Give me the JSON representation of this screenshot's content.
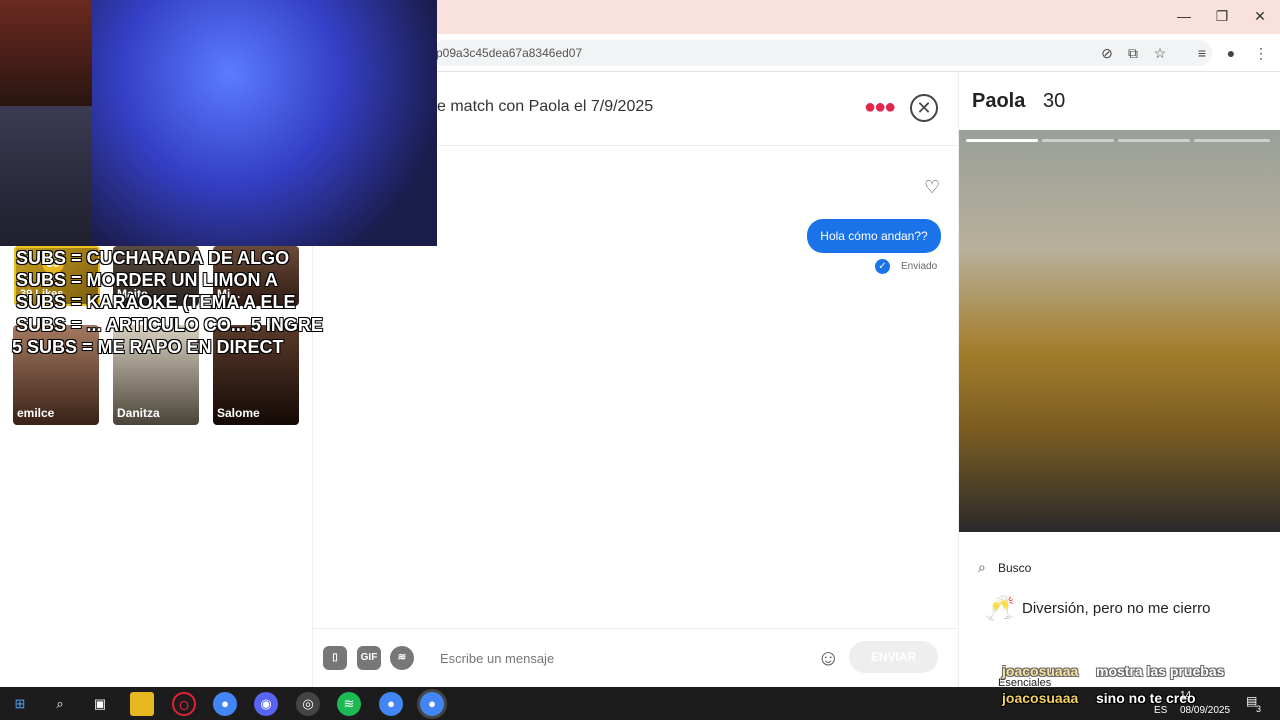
{
  "browser": {
    "url": "p09a3c45dea67a8346ed07",
    "window_controls": {
      "minimize": "—",
      "maximize": "❐",
      "close": "✕"
    }
  },
  "stream_overlay": {
    "lines": [
      "SUBS = CUCHARADA DE ALGO",
      "SUBS = MORDER UN LIMON A",
      "SUBS = KARAOKE (TEMA A ELE",
      "SUBS = ... ARTICULO CO... 5 INGRE",
      "5 SUBS = ME RAPO EN DIRECT"
    ],
    "chat": [
      {
        "user": "joacosuaaa",
        "message": "mostra las pruebas"
      },
      {
        "user": "joacosuaaa",
        "message": "sino no te creo"
      }
    ]
  },
  "matches": {
    "likes_count": "39",
    "likes_label": "39 Likes",
    "row1": [
      {
        "name": "Maite"
      },
      {
        "name": "Mi..."
      }
    ],
    "row2": [
      {
        "name": "emilce"
      },
      {
        "name": "Danitza"
      },
      {
        "name": "Salome"
      }
    ]
  },
  "chat": {
    "match_info": "e match con Paola el 7/9/2025",
    "messages": [
      {
        "text": "Hola cómo andan??",
        "status": "Enviado"
      }
    ],
    "composer": {
      "placeholder": "Escribe un mensaje",
      "gif_label": "GIF",
      "send_label": "ENVIAR"
    }
  },
  "profile": {
    "name": "Paola",
    "age": "30",
    "looking_for_title": "Busco",
    "looking_for": "Diversión, pero no me cierro",
    "section": "Esenciales"
  },
  "taskbar": {
    "time": "14",
    "date": "08/09/2025",
    "lang": "ES",
    "notif_count": "3"
  },
  "colors": {
    "accent": "#1a73e8",
    "tinder_red": "#e2264d",
    "titlebar": "#f9e1dd"
  }
}
